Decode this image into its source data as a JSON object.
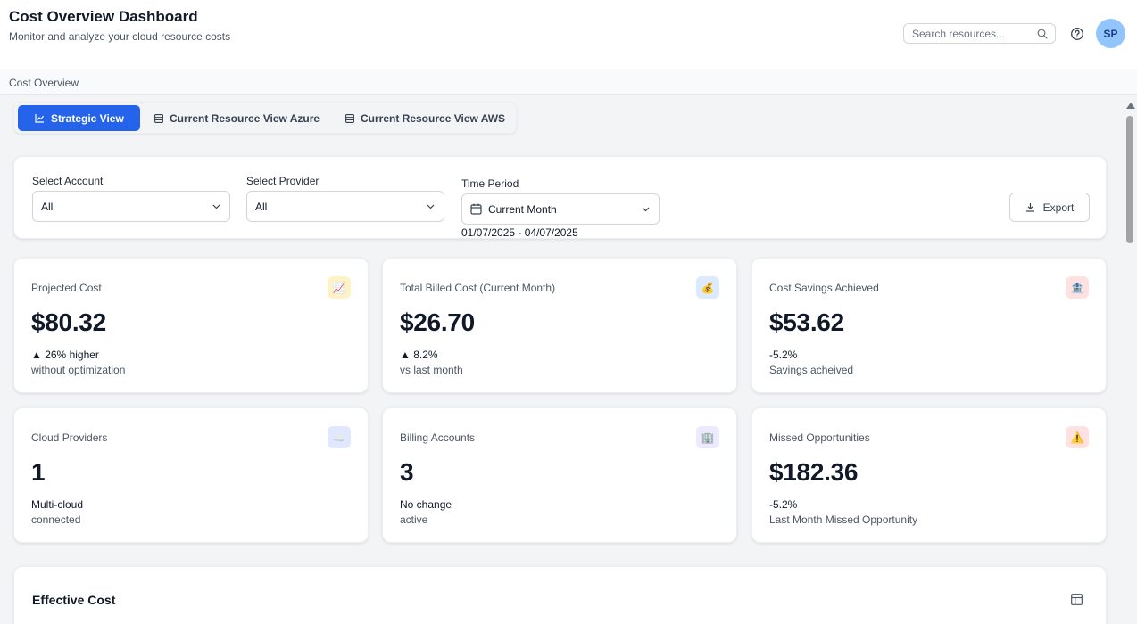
{
  "header": {
    "title": "Cost Overview Dashboard",
    "subtitle": "Monitor and analyze your cloud resource costs",
    "search_placeholder": "Search resources...",
    "avatar_initials": "SP"
  },
  "breadcrumb": "Cost Overview",
  "tabs": [
    {
      "label": "Strategic View",
      "icon": "line-chart-icon",
      "active": true
    },
    {
      "label": "Current Resource View Azure",
      "icon": "table-icon",
      "active": false
    },
    {
      "label": "Current Resource View AWS",
      "icon": "table-icon",
      "active": false
    }
  ],
  "filters": {
    "account": {
      "label": "Select Account",
      "value": "All"
    },
    "provider": {
      "label": "Select Provider",
      "value": "All"
    },
    "period": {
      "label": "Time Period",
      "value": "Current Month",
      "range": "01/07/2025 - 04/07/2025"
    },
    "export_label": "Export"
  },
  "metrics": [
    {
      "label": "Projected Cost",
      "value": "$80.32",
      "change": "▲ 26% higher",
      "note": "without optimization",
      "icon": "chart-increasing-icon",
      "icon_bg": "#fef3c7"
    },
    {
      "label": "Total Billed Cost (Current Month)",
      "value": "$26.70",
      "change": "▲ 8.2%",
      "note": "vs last month",
      "icon": "money-bag-icon",
      "icon_bg": "#dbeafe"
    },
    {
      "label": "Cost Savings Achieved",
      "value": "$53.62",
      "change": "-5.2%",
      "note": "Savings acheived",
      "icon": "bank-icon",
      "icon_bg": "#fee2e2"
    },
    {
      "label": "Cloud Providers",
      "value": "1",
      "change": "Multi-cloud",
      "note": "connected",
      "icon": "cloud-icon",
      "icon_bg": "#e0e7ff"
    },
    {
      "label": "Billing Accounts",
      "value": "3",
      "change": "No change",
      "note": "active",
      "icon": "building-icon",
      "icon_bg": "#ede9fe"
    },
    {
      "label": "Missed Opportunities",
      "value": "$182.36",
      "change": "-5.2%",
      "note": "Last Month Missed Opportunity",
      "icon": "warning-icon",
      "icon_bg": "#fee2e2"
    }
  ],
  "effective_cost": {
    "title": "Effective Cost"
  },
  "colors": {
    "accent": "#2563eb",
    "avatar_bg": "#93c5fd"
  }
}
